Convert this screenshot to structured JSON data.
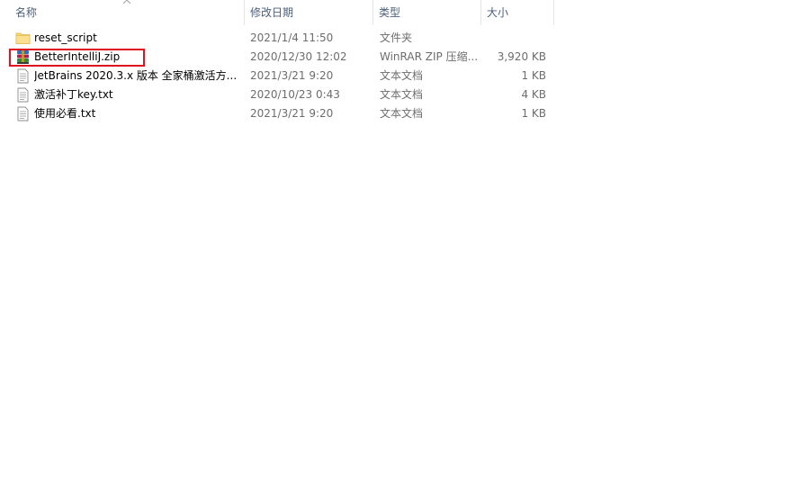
{
  "columns": {
    "name": "名称",
    "date": "修改日期",
    "type": "类型",
    "size": "大小"
  },
  "files": [
    {
      "name": "reset_script",
      "date": "2021/1/4 11:50",
      "type": "文件夹",
      "size": "",
      "icon": "folder-icon"
    },
    {
      "name": "BetterIntelliJ.zip",
      "date": "2020/12/30 12:02",
      "type": "WinRAR ZIP 压缩...",
      "size": "3,920 KB",
      "icon": "winrar-archive-icon"
    },
    {
      "name": "JetBrains 2020.3.x 版本 全家桶激活方...",
      "date": "2021/3/21 9:20",
      "type": "文本文档",
      "size": "1 KB",
      "icon": "text-document-icon"
    },
    {
      "name": "激活补丁key.txt",
      "date": "2020/10/23 0:43",
      "type": "文本文档",
      "size": "4 KB",
      "icon": "text-document-icon"
    },
    {
      "name": "使用必看.txt",
      "date": "2021/3/21 9:20",
      "type": "文本文档",
      "size": "1 KB",
      "icon": "text-document-icon"
    }
  ],
  "colors": {
    "highlight": "#e0101c",
    "header_text": "#4c607a",
    "secondary_text": "#6d6d6d",
    "folder": "#f8d775"
  }
}
